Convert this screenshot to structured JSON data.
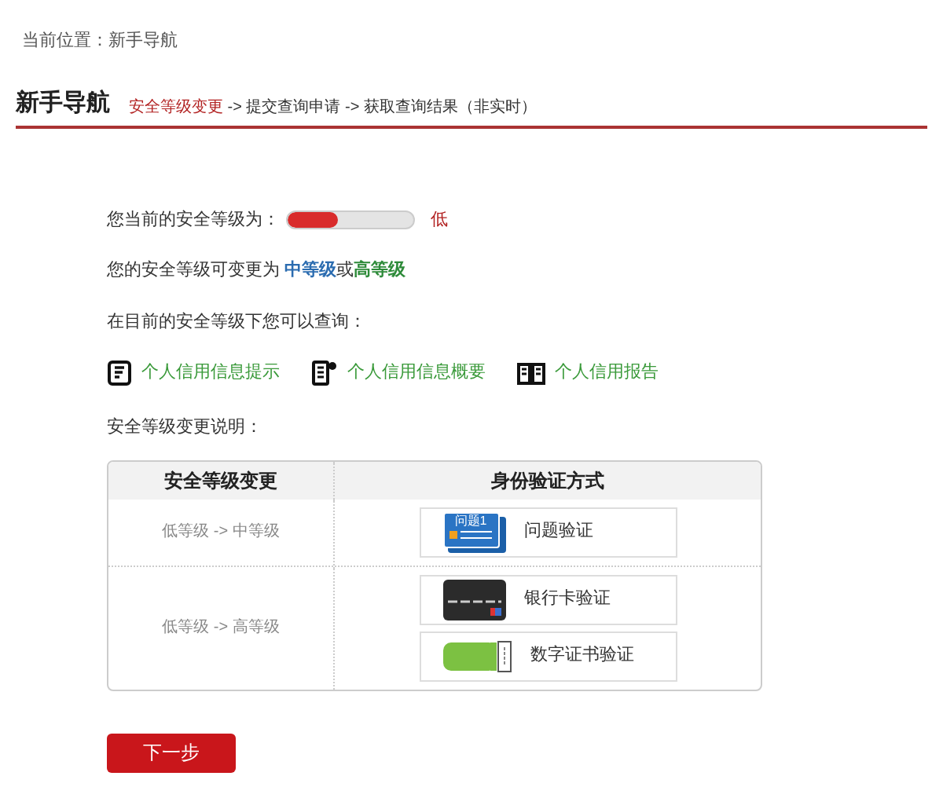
{
  "breadcrumb": {
    "label": "当前位置：",
    "current": "新手导航"
  },
  "header": {
    "title": "新手导航",
    "separator": " -> ",
    "steps": [
      {
        "label": "安全等级变更",
        "selected": true
      },
      {
        "label": "提交查询申请",
        "selected": false
      },
      {
        "label": "获取查询结果（非实时）",
        "selected": false
      }
    ]
  },
  "security": {
    "label": "您当前的安全等级为：",
    "level": 0.4,
    "reading": "低"
  },
  "upgrade": {
    "prefix": "您的安全等级可变更为 ",
    "joiner": "或",
    "options": [
      {
        "label": "中等级",
        "color": "#2b6cb0"
      },
      {
        "label": "高等级",
        "color": "#2e8b3a"
      }
    ]
  },
  "query_intro": "在目前的安全等级下您可以查询：",
  "queries": [
    {
      "kind": "hint",
      "label": "个人信用信息提示"
    },
    {
      "kind": "summary",
      "label": "个人信用信息概要"
    },
    {
      "kind": "report",
      "label": "个人信用报告"
    }
  ],
  "explain_title": "安全等级变更说明：",
  "table": {
    "columns": [
      "安全等级变更",
      "身份验证方式"
    ],
    "rows": [
      {
        "change": "低等级 -> 中等级",
        "methods": [
          {
            "kind": "question",
            "icon_label": "问题1",
            "label": "问题验证"
          }
        ]
      },
      {
        "change": "低等级 -> 高等级",
        "methods": [
          {
            "kind": "bank_card",
            "label": "银行卡验证"
          },
          {
            "kind": "certificate",
            "label": "数字证书验证"
          }
        ]
      }
    ]
  },
  "next_button": "下一步"
}
